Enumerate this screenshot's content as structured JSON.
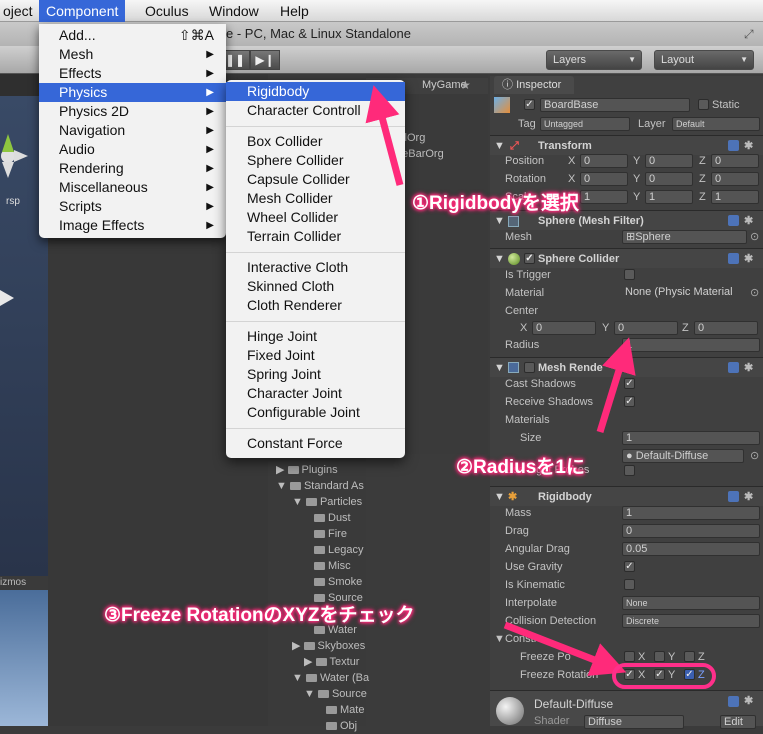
{
  "menubar": {
    "items": [
      {
        "label": "oject"
      },
      {
        "label": "Component"
      },
      {
        "label": "Oculus"
      },
      {
        "label": "Window"
      },
      {
        "label": "Help"
      }
    ]
  },
  "toolbar": {
    "window_title": "e - PC, Mac & Linux Standalone",
    "layers_label": "Layers",
    "layout_label": "Layout"
  },
  "component_menu": {
    "items": [
      {
        "label": "Add...",
        "shortcut": "⇧⌘A"
      },
      {
        "label": "Mesh"
      },
      {
        "label": "Effects"
      },
      {
        "label": "Physics"
      },
      {
        "label": "Physics 2D"
      },
      {
        "label": "Navigation"
      },
      {
        "label": "Audio"
      },
      {
        "label": "Rendering"
      },
      {
        "label": "Miscellaneous"
      },
      {
        "label": "Scripts"
      },
      {
        "label": "Image Effects"
      }
    ]
  },
  "physics_menu": {
    "items": [
      "Rigidbody",
      "Character Controll",
      "Box Collider",
      "Sphere Collider",
      "Capsule Collider",
      "Mesh Collider",
      "Wheel Collider",
      "Terrain Collider",
      "Interactive Cloth",
      "Skinned Cloth",
      "Cloth Renderer",
      "Hinge Joint",
      "Fixed Joint",
      "Spring Joint",
      "Character Joint",
      "Configurable Joint",
      "Constant Force"
    ]
  },
  "left_panel": {
    "tab_label": "ects",
    "persp_label": "rsp",
    "gizmos_label": "izmos"
  },
  "hierarchy": {
    "tab_label": "MyGame",
    "items": [
      "allOrg",
      "deBarOrg"
    ]
  },
  "project_tree": {
    "items": [
      "Plugins",
      "Standard As",
      "Particles",
      "Dust",
      "Fire",
      "Legacy",
      "Misc",
      "Smoke",
      "Source",
      "Water",
      "Skyboxes",
      "Textur",
      "Water (Ba",
      "Source",
      "Mate",
      "Obj"
    ]
  },
  "inspector": {
    "tab_label": "Inspector",
    "object_name": "BoardBase",
    "static_label": "Static",
    "tag_label": "Tag",
    "tag_value": "Untagged",
    "layer_label": "Layer",
    "layer_value": "Default",
    "transform": {
      "title": "Transform",
      "position_label": "Position",
      "rotation_label": "Rotation",
      "scale_label": "Scale",
      "x": "X",
      "y": "Y",
      "z": "Z",
      "pos": [
        "0",
        "0",
        "0"
      ],
      "rot": [
        "0",
        "0",
        "0"
      ],
      "scale": [
        "1",
        "1",
        "1"
      ]
    },
    "mesh_filter": {
      "title": "Sphere (Mesh Filter)",
      "mesh_label": "Mesh",
      "mesh_value": "Sphere"
    },
    "sphere_collider": {
      "title": "Sphere Collider",
      "is_trigger_label": "Is Trigger",
      "material_label": "Material",
      "material_value": "None (Physic Material",
      "center_label": "Center",
      "center": [
        "0",
        "0",
        "0"
      ],
      "radius_label": "Radius",
      "radius_value": "1"
    },
    "mesh_renderer": {
      "title": "Mesh Rende",
      "cast_shadows_label": "Cast Shadows",
      "receive_shadows_label": "Receive Shadows",
      "materials_label": "Materials",
      "size_label": "Size",
      "size_value": "1",
      "element_value": "Default-Diffuse",
      "light_probes_label": "Use Light Probes"
    },
    "rigidbody": {
      "title": "Rigidbody",
      "mass_label": "Mass",
      "mass_value": "1",
      "drag_label": "Drag",
      "drag_value": "0",
      "angular_drag_label": "Angular Drag",
      "angular_drag_value": "0.05",
      "use_gravity_label": "Use Gravity",
      "is_kinematic_label": "Is Kinematic",
      "interpolate_label": "Interpolate",
      "interpolate_value": "None",
      "collision_label": "Collision Detection",
      "collision_value": "Discrete",
      "constraints_label": "Constra",
      "freeze_pos_label": "Freeze Po",
      "freeze_rot_label": "Freeze Rotation",
      "x": "X",
      "y": "Y",
      "z": "Z"
    },
    "material": {
      "title": "Default-Diffuse",
      "shader_label": "Shader",
      "shader_value": "Diffuse",
      "edit_label": "Edit"
    }
  },
  "annotations": {
    "step1": "①Rigidbodyを選択",
    "step2": "②Radiusを1に",
    "step3": "③Freeze RotationのXYZをチェック",
    "color": "#ff2a7a"
  }
}
